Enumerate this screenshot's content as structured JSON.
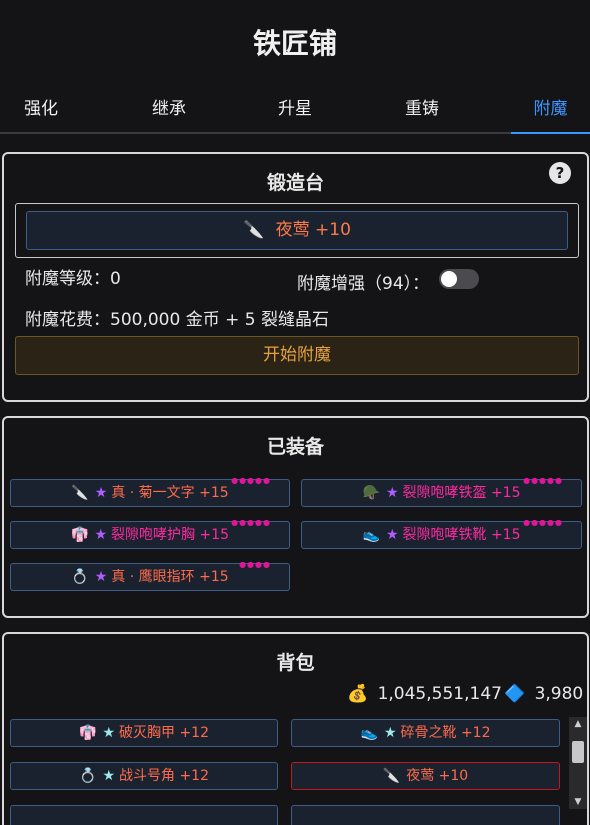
{
  "page_title": "铁匠铺",
  "tabs": [
    {
      "label": "强化"
    },
    {
      "label": "继承"
    },
    {
      "label": "升星"
    },
    {
      "label": "重铸"
    },
    {
      "label": "附魔"
    }
  ],
  "active_tab": "附魔",
  "forge": {
    "title": "锻造台",
    "help": "?",
    "selected_item": {
      "icon": "🔪",
      "name": "夜莺 +10",
      "color": "#ff7a45"
    },
    "enchant_level_label": "附魔等级：0",
    "enchant_boost_label": "附魔增强（94）：",
    "enchant_boost_on": false,
    "cost_label": "附魔花费：500,000 金币 + 5 裂缝晶石",
    "start_button": "开始附魔"
  },
  "equipped": {
    "title": "已装备",
    "items": [
      {
        "icon": "🔪",
        "star": "★",
        "name": "真 · 菊一文字 +15",
        "dots": "●●●●●",
        "name_color": "#ff6b4a"
      },
      {
        "icon": "🪖",
        "star": "★",
        "name": "裂隙咆哮铁盔 +15",
        "dots": "●●●●●",
        "name_color": "#ff2a9e"
      },
      {
        "icon": "👘",
        "star": "★",
        "name": "裂隙咆哮护胸 +15",
        "dots": "●●●●●",
        "name_color": "#ff2a9e"
      },
      {
        "icon": "👟",
        "star": "★",
        "name": "裂隙咆哮铁靴 +15",
        "dots": "●●●●●",
        "name_color": "#ff2a9e"
      },
      {
        "icon": "💍",
        "star": "★",
        "name": "真 · 鹰眼指环 +15",
        "dots": "●●●●",
        "name_color": "#ff6b4a"
      }
    ]
  },
  "backpack": {
    "title": "背包",
    "gold_icon": "💰",
    "gold": "1,045,551,147",
    "gem_icon": "🔷",
    "gems": "3,980",
    "items": [
      {
        "icon": "👘",
        "star": "★",
        "name": "破灭胸甲 +12",
        "name_color": "#ff6b4a"
      },
      {
        "icon": "👟",
        "star": "★",
        "name": "碎骨之靴 +12",
        "name_color": "#ff6b4a"
      },
      {
        "icon": "💍",
        "star": "★",
        "name": "战斗号角 +12",
        "name_color": "#ff6b4a"
      },
      {
        "icon": "🔪",
        "star": "",
        "name": "夜莺 +10",
        "name_color": "#ff6b4a",
        "selected": true
      }
    ]
  },
  "colors": {
    "accent": "#3d96ff",
    "star_equipped": "#b15cff",
    "star_backpack": "#9de8e8",
    "enhance_dots": "#e0169a"
  }
}
